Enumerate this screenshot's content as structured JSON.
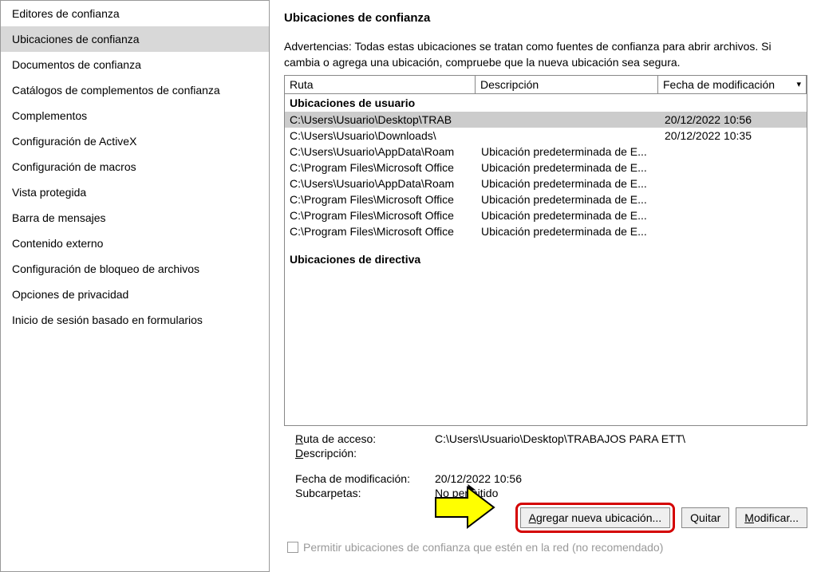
{
  "sidebar": {
    "items": [
      {
        "label": "Editores de confianza",
        "selected": false
      },
      {
        "label": "Ubicaciones de confianza",
        "selected": true
      },
      {
        "label": "Documentos de confianza",
        "selected": false
      },
      {
        "label": "Catálogos de complementos de confianza",
        "selected": false
      },
      {
        "label": "Complementos",
        "selected": false
      },
      {
        "label": "Configuración de ActiveX",
        "selected": false
      },
      {
        "label": "Configuración de macros",
        "selected": false
      },
      {
        "label": "Vista protegida",
        "selected": false
      },
      {
        "label": "Barra de mensajes",
        "selected": false
      },
      {
        "label": "Contenido externo",
        "selected": false
      },
      {
        "label": "Configuración de bloqueo de archivos",
        "selected": false
      },
      {
        "label": "Opciones de privacidad",
        "selected": false
      },
      {
        "label": "Inicio de sesión basado en formularios",
        "selected": false
      }
    ]
  },
  "main": {
    "title": "Ubicaciones de confianza",
    "warning": "Advertencias: Todas estas ubicaciones se tratan como fuentes de confianza para abrir archivos. Si cambia o agrega una ubicación, compruebe que la nueva ubicación sea segura.",
    "columns": {
      "path": "Ruta",
      "desc": "Descripción",
      "date": "Fecha de modificación"
    },
    "section_user": "Ubicaciones de usuario",
    "rows": [
      {
        "path": "C:\\Users\\Usuario\\Desktop\\TRAB",
        "desc": "",
        "date": "20/12/2022 10:56",
        "selected": true
      },
      {
        "path": "C:\\Users\\Usuario\\Downloads\\",
        "desc": "",
        "date": "20/12/2022 10:35"
      },
      {
        "path": "C:\\Users\\Usuario\\AppData\\Roam",
        "desc": "Ubicación predeterminada de E...",
        "date": ""
      },
      {
        "path": "C:\\Program Files\\Microsoft Office",
        "desc": "Ubicación predeterminada de E...",
        "date": ""
      },
      {
        "path": "C:\\Users\\Usuario\\AppData\\Roam",
        "desc": "Ubicación predeterminada de E...",
        "date": ""
      },
      {
        "path": "C:\\Program Files\\Microsoft Office",
        "desc": "Ubicación predeterminada de E...",
        "date": ""
      },
      {
        "path": "C:\\Program Files\\Microsoft Office",
        "desc": "Ubicación predeterminada de E...",
        "date": ""
      },
      {
        "path": "C:\\Program Files\\Microsoft Office",
        "desc": "Ubicación predeterminada de E...",
        "date": ""
      }
    ],
    "section_policy": "Ubicaciones de directiva",
    "details": {
      "path_label": "Ruta de acceso:",
      "path_value": "C:\\Users\\Usuario\\Desktop\\TRABAJOS PARA ETT\\",
      "desc_label": "Descripción:",
      "desc_value": "",
      "date_label": "Fecha de modificación:",
      "date_value": "20/12/2022 10:56",
      "subfolders_label": "Subcarpetas:",
      "subfolders_value": "No permitido"
    },
    "buttons": {
      "add": "Agregar nueva ubicación...",
      "remove": "Quitar",
      "modify": "Modificar..."
    },
    "checkbox_label": "Permitir ubicaciones de confianza que estén en la red (no recomendado)"
  }
}
